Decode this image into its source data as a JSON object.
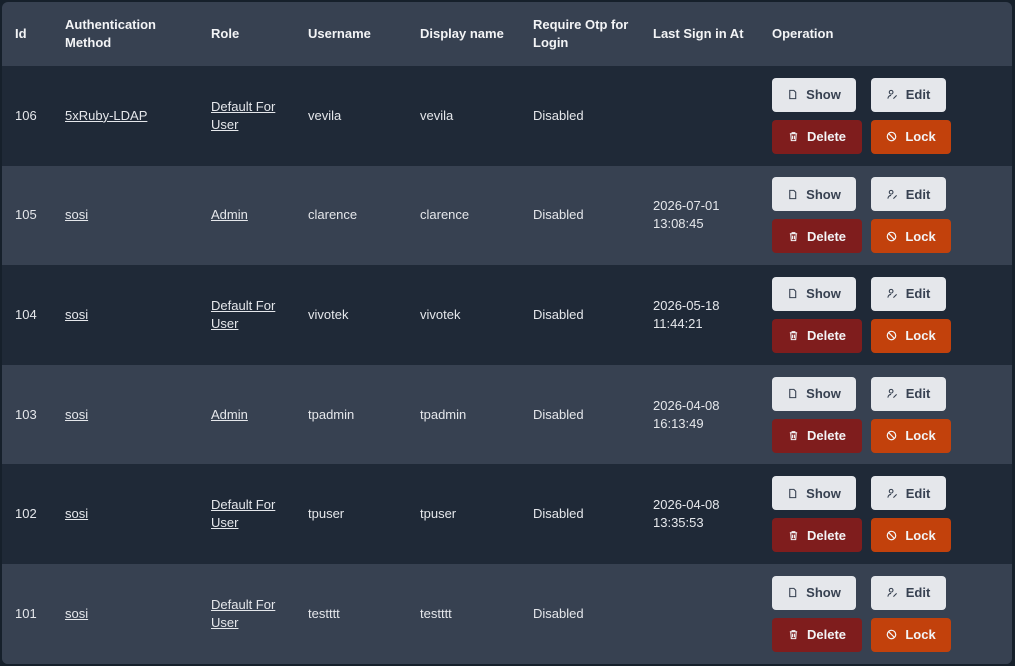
{
  "headers": {
    "id": "Id",
    "auth": "Authentication Method",
    "role": "Role",
    "username": "Username",
    "display": "Display name",
    "otp": "Require Otp for Login",
    "last": "Last Sign in At",
    "ops": "Operation"
  },
  "buttons": {
    "show": "Show",
    "edit": "Edit",
    "delete": "Delete",
    "lock": "Lock"
  },
  "rows": [
    {
      "id": "106",
      "auth": "5xRuby-LDAP",
      "role": "Default For User",
      "username": "vevila",
      "display": "vevila",
      "otp": "Disabled",
      "last_date": "",
      "last_time": ""
    },
    {
      "id": "105",
      "auth": "sosi",
      "role": "Admin",
      "username": "clarence",
      "display": "clarence",
      "otp": "Disabled",
      "last_date": "2026-07-01",
      "last_time": "13:08:45"
    },
    {
      "id": "104",
      "auth": "sosi",
      "role": "Default For User",
      "username": "vivotek",
      "display": "vivotek",
      "otp": "Disabled",
      "last_date": "2026-05-18",
      "last_time": "11:44:21"
    },
    {
      "id": "103",
      "auth": "sosi",
      "role": "Admin",
      "username": "tpadmin",
      "display": "tpadmin",
      "otp": "Disabled",
      "last_date": "2026-04-08",
      "last_time": "16:13:49"
    },
    {
      "id": "102",
      "auth": "sosi",
      "role": "Default For User",
      "username": "tpuser",
      "display": "tpuser",
      "otp": "Disabled",
      "last_date": "2026-04-08",
      "last_time": "13:35:53"
    },
    {
      "id": "101",
      "auth": "sosi",
      "role": "Default For User",
      "username": "testttt",
      "display": "testttt",
      "otp": "Disabled",
      "last_date": "",
      "last_time": ""
    }
  ],
  "icons": {
    "show": "document-icon",
    "edit": "user-edit-icon",
    "delete": "trash-icon",
    "lock": "ban-icon"
  }
}
